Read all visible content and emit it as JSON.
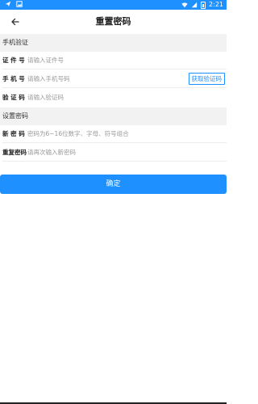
{
  "status": {
    "time": "2:21",
    "icons": [
      "send-icon",
      "image-icon",
      "wifi-icon",
      "signal-icon",
      "battery-icon"
    ]
  },
  "nav": {
    "title": "重置密码",
    "back_icon": "arrow-left-icon"
  },
  "phone_section": {
    "title": "手机验证",
    "rows": [
      {
        "label": "证 件 号",
        "placeholder": "请输入证件号"
      },
      {
        "label": "手 机 号",
        "placeholder": "请输入手机号码",
        "action": "获取验证码"
      },
      {
        "label": "验 证 码",
        "placeholder": "请输入验证码"
      }
    ]
  },
  "password_section": {
    "title": "设置密码",
    "rows": [
      {
        "label": "新 密 码",
        "placeholder": "密码为6~16位数字、字母、符号组合"
      },
      {
        "label": "重复密码",
        "placeholder": "请再次输入新密码"
      }
    ]
  },
  "confirm_label": "确定",
  "colors": {
    "accent": "#1e90ff",
    "section_bg": "#f2f2f2"
  }
}
